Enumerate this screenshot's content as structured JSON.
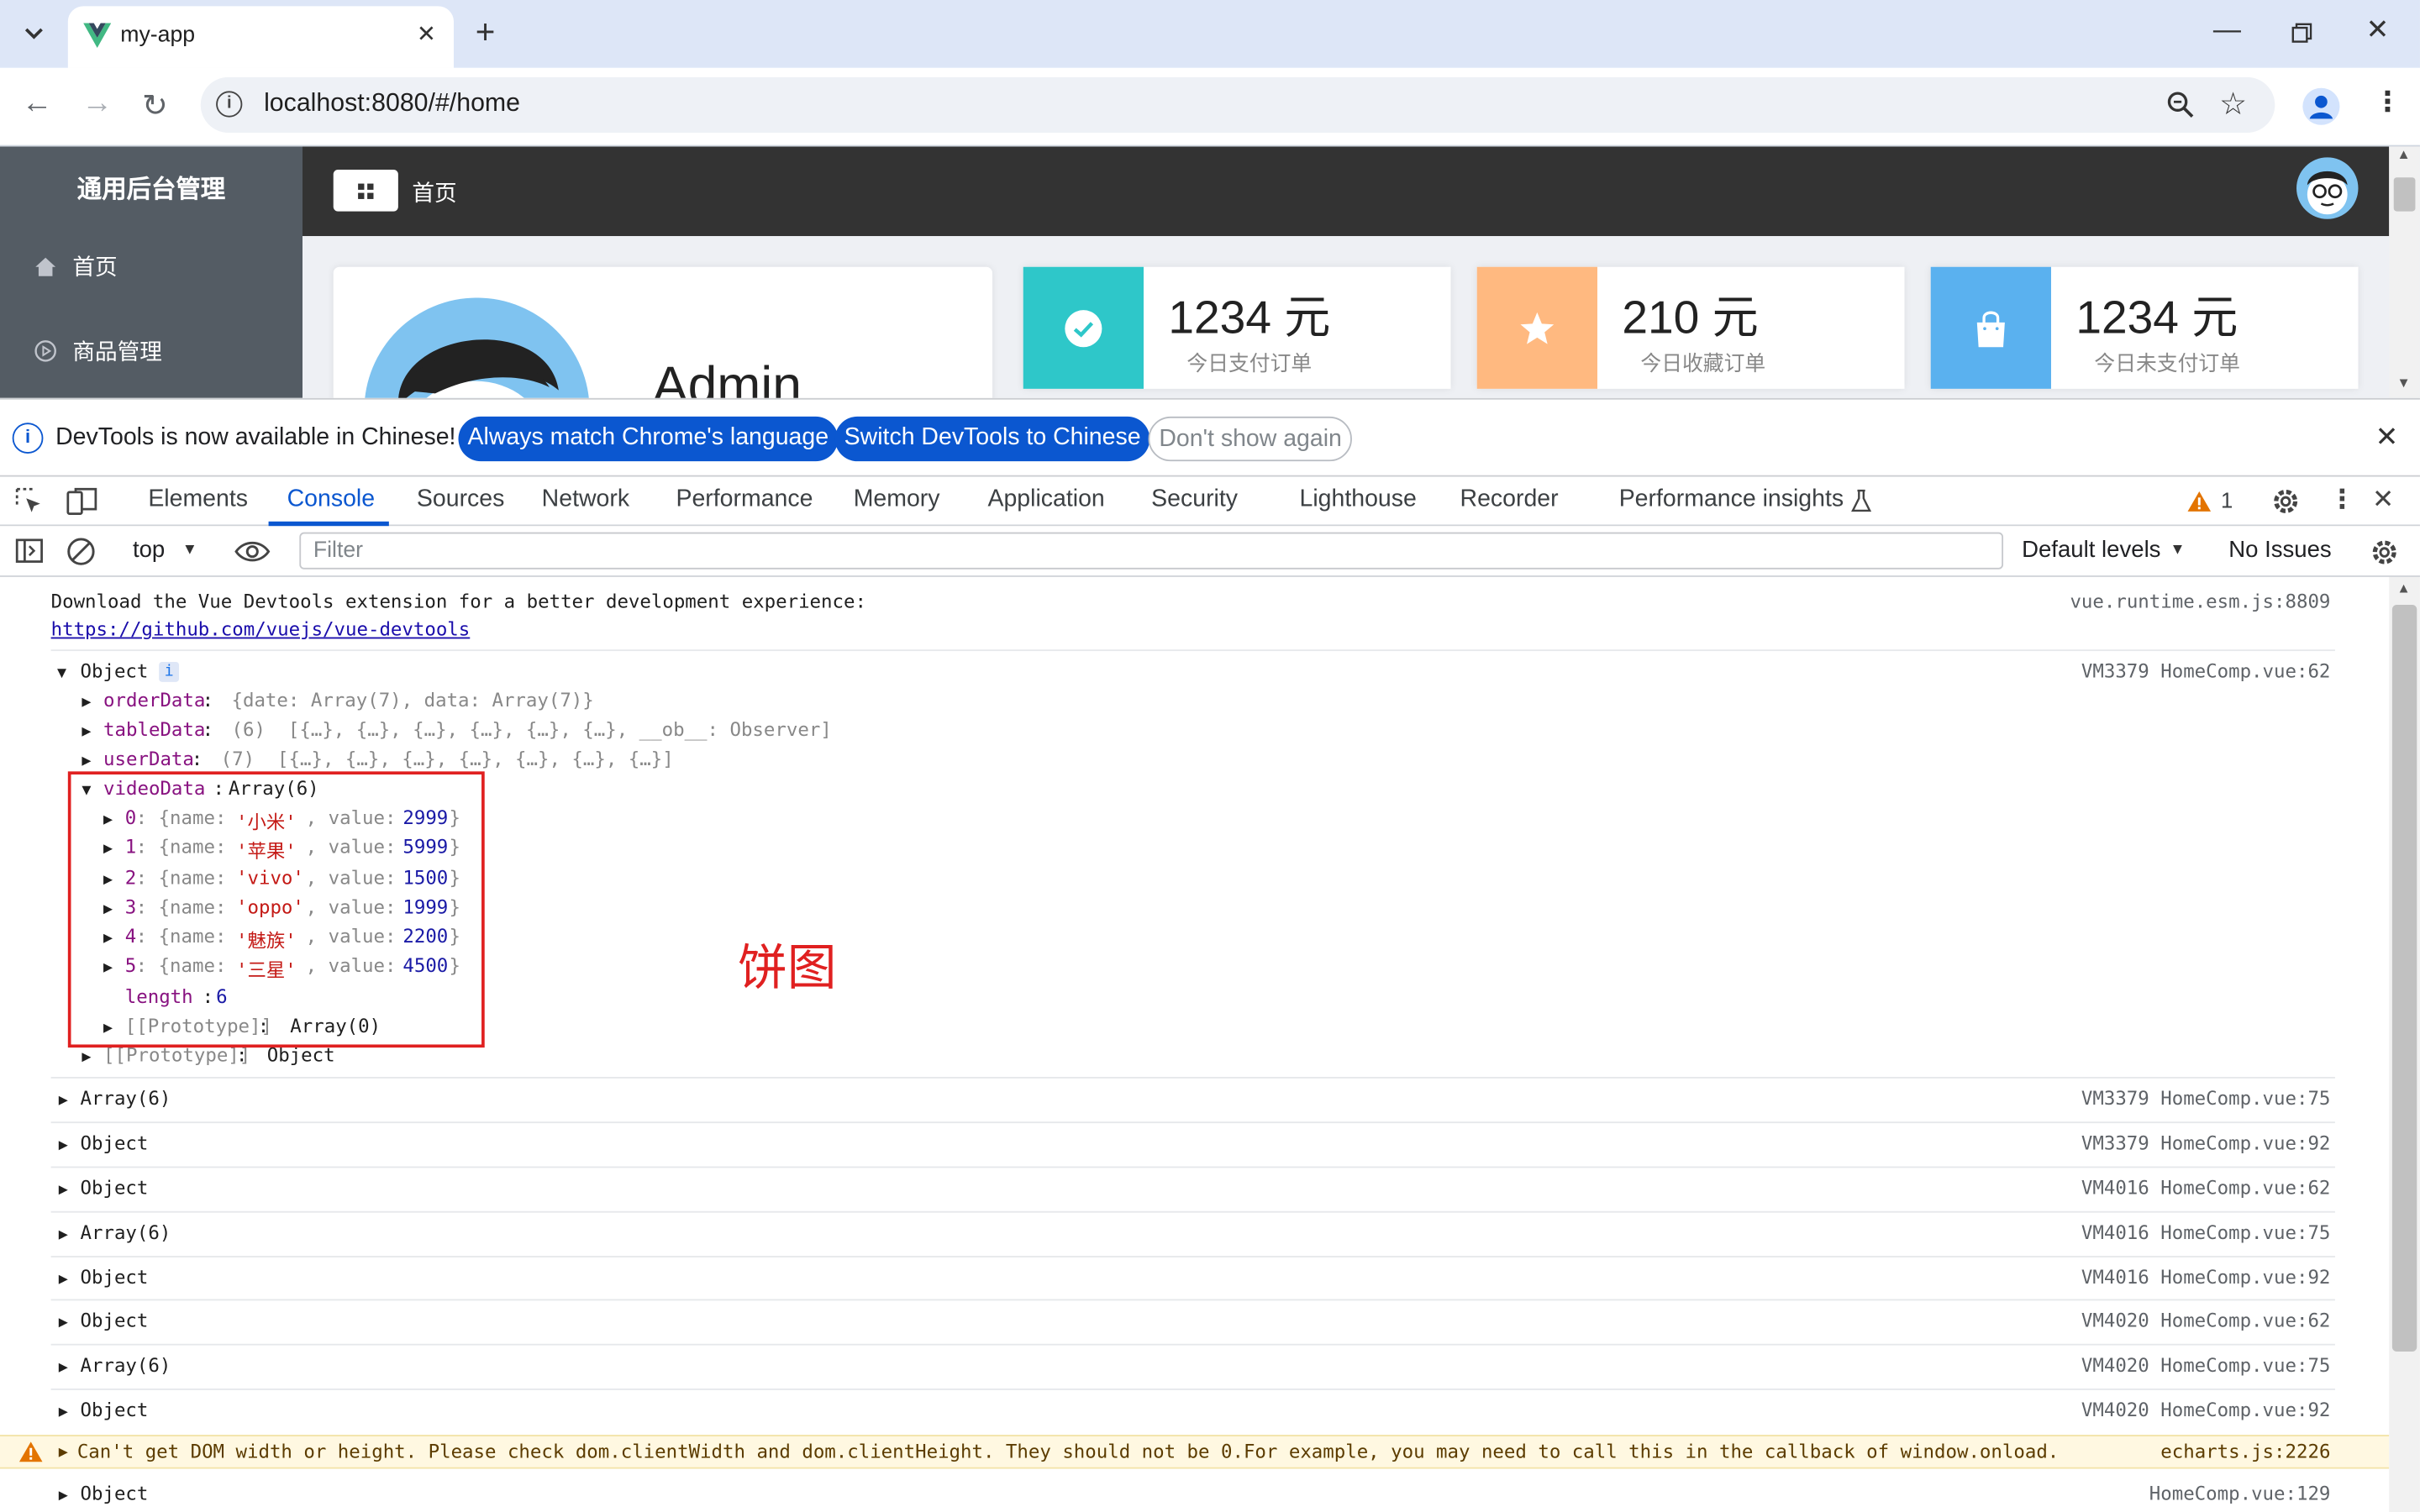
{
  "browser": {
    "tab_title": "my-app",
    "url": "localhost:8080/#/home"
  },
  "app": {
    "sidebar_title": "通用后台管理",
    "menu": [
      {
        "label": "首页",
        "icon": "home-icon"
      },
      {
        "label": "商品管理",
        "icon": "play-circle-icon"
      }
    ],
    "breadcrumb": "首页",
    "profile_name": "Admin",
    "stats": [
      {
        "value": "1234 元",
        "label": "今日支付订单",
        "color": "#2ec7c9",
        "icon": "check-circle-icon"
      },
      {
        "value": "210 元",
        "label": "今日收藏订单",
        "color": "#ffb980",
        "icon": "star-icon"
      },
      {
        "value": "1234 元",
        "label": "今日未支付订单",
        "color": "#5ab1ef",
        "icon": "shopping-bag-icon"
      }
    ]
  },
  "infobar": {
    "message": "DevTools is now available in Chinese!",
    "btn_match": "Always match Chrome's language",
    "btn_switch": "Switch DevTools to Chinese",
    "btn_dismiss": "Don't show again"
  },
  "devtools": {
    "tabs": [
      "Elements",
      "Console",
      "Sources",
      "Network",
      "Performance",
      "Memory",
      "Application",
      "Security",
      "Lighthouse",
      "Recorder",
      "Performance insights"
    ],
    "active_tab": "Console",
    "warning_count": "1",
    "context": "top",
    "filter_placeholder": "Filter",
    "levels": "Default levels",
    "issues": "No Issues"
  },
  "console": {
    "vue_msg_1": "Download the Vue Devtools extension for a better development experience:",
    "vue_msg_link": "https://github.com/vuejs/vue-devtools",
    "vue_msg_src": "vue.runtime.esm.js:8809",
    "obj_label": "Object",
    "obj_src": "VM3379 HomeComp.vue:62",
    "order_key": "orderData",
    "order_val": "{date: Array(7), data: Array(7)}",
    "table_key": "tableData",
    "table_val": "(6)  [{…}, {…}, {…}, {…}, {…}, {…}, __ob__: Observer]",
    "user_key": "userData",
    "user_val": "(7)  [{…}, {…}, {…}, {…}, {…}, {…}, {…}]",
    "video_key": "videoData",
    "video_type": "Array(6)",
    "video_items": [
      {
        "idx": "0",
        "name": "'小米'",
        "value": "2999"
      },
      {
        "idx": "1",
        "name": "'苹果'",
        "value": "5999"
      },
      {
        "idx": "2",
        "name": "'vivo'",
        "value": "1500"
      },
      {
        "idx": "3",
        "name": "'oppo'",
        "value": "1999"
      },
      {
        "idx": "4",
        "name": "'魅族'",
        "value": "2200"
      },
      {
        "idx": "5",
        "name": "'三星'",
        "value": "4500"
      }
    ],
    "length_key": "length",
    "length_val": "6",
    "proto_arr": "[[Prototype]]",
    "proto_arr_val": "Array(0)",
    "proto_obj_val": "Object",
    "annotation": "饼图",
    "rows": [
      {
        "label": "Array(6)",
        "src": "VM3379 HomeComp.vue:75"
      },
      {
        "label": "Object",
        "src": "VM3379 HomeComp.vue:92"
      },
      {
        "label": "Object",
        "src": "VM4016 HomeComp.vue:62"
      },
      {
        "label": "Array(6)",
        "src": "VM4016 HomeComp.vue:75"
      },
      {
        "label": "Object",
        "src": "VM4016 HomeComp.vue:92"
      },
      {
        "label": "Object",
        "src": "VM4020 HomeComp.vue:62"
      },
      {
        "label": "Array(6)",
        "src": "VM4020 HomeComp.vue:75"
      },
      {
        "label": "Object",
        "src": "VM4020 HomeComp.vue:92"
      }
    ],
    "warn_text": "Can't get DOM width or height. Please check dom.clientWidth and dom.clientHeight. They should not be 0.For example, you may need to call this in the callback of window.onload.",
    "warn_src": "echarts.js:2226",
    "last_label": "Object",
    "last_src": "HomeComp.vue:129"
  }
}
